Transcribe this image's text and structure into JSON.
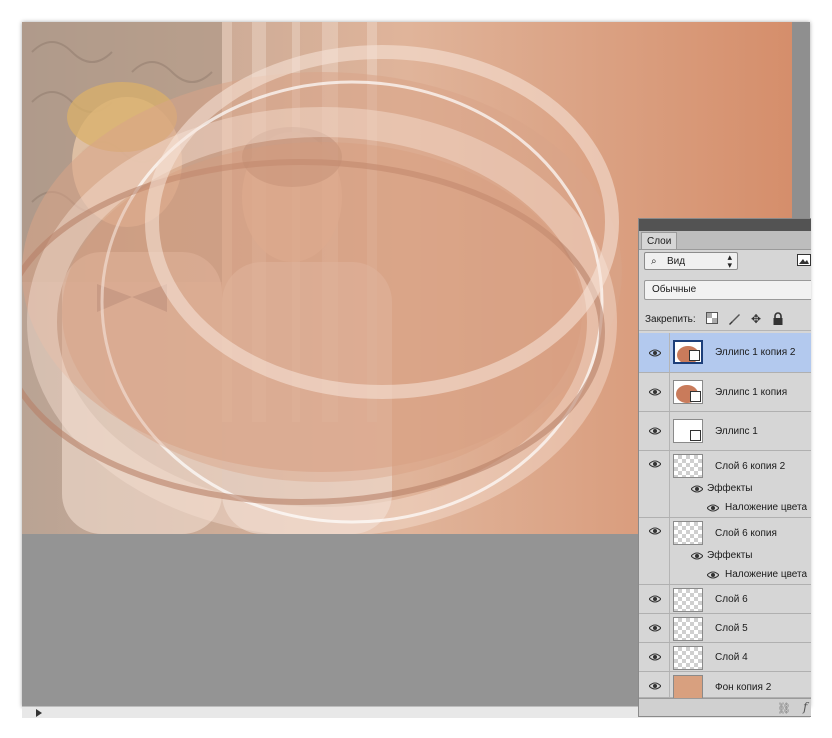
{
  "layers_panel": {
    "tab_label": "Слои",
    "filter": {
      "selected": "Вид"
    },
    "blend_mode": "Обычные",
    "lock_label": "Закрепить:",
    "layers": [
      {
        "name": "Эллипс 1 копия 2",
        "thumb": "shape-fill",
        "selected": true
      },
      {
        "name": "Эллипс 1 копия",
        "thumb": "shape-fill",
        "selected": false
      },
      {
        "name": "Эллипс 1",
        "thumb": "shape-white",
        "selected": false
      },
      {
        "name": "Слой 6 копия 2",
        "thumb": "transparent",
        "effects_label": "Эффекты",
        "effect": "Наложение цвета"
      },
      {
        "name": "Слой 6 копия",
        "thumb": "transparent",
        "effects_label": "Эффекты",
        "effect": "Наложение цвета"
      },
      {
        "name": "Слой 6",
        "thumb": "transparent"
      },
      {
        "name": "Слой 5",
        "thumb": "transparent"
      },
      {
        "name": "Слой 4",
        "thumb": "transparent"
      },
      {
        "name": "Фон копия 2",
        "thumb": "photo"
      }
    ]
  },
  "colors": {
    "workspace": "#949494",
    "selection": "#b3c9ee",
    "canvas_accent": "#d58e6b"
  }
}
